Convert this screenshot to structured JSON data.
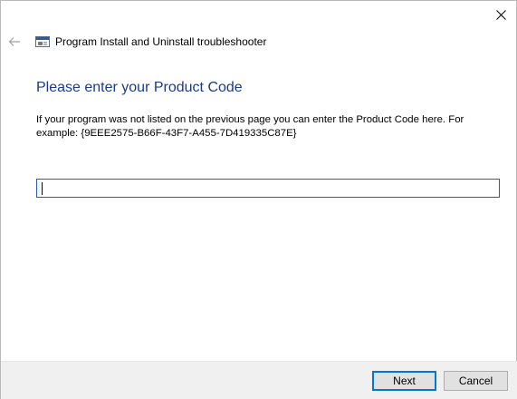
{
  "window": {
    "title": "Program Install and Uninstall troubleshooter",
    "close_icon": "close-icon",
    "back_icon": "back-arrow-icon",
    "app_icon": "troubleshooter-app-icon"
  },
  "main": {
    "heading": "Please enter your Product Code",
    "description": "If your program was not listed on the previous page you can enter the Product Code here. For example: {9EEE2575-B66F-43F7-A455-7D419335C87E}",
    "product_code_value": "",
    "product_code_placeholder": ""
  },
  "footer": {
    "next_label": "Next",
    "cancel_label": "Cancel"
  },
  "colors": {
    "heading": "#1a3b8c",
    "accent": "#0078d7",
    "footer_bg": "#f0f0f0"
  }
}
